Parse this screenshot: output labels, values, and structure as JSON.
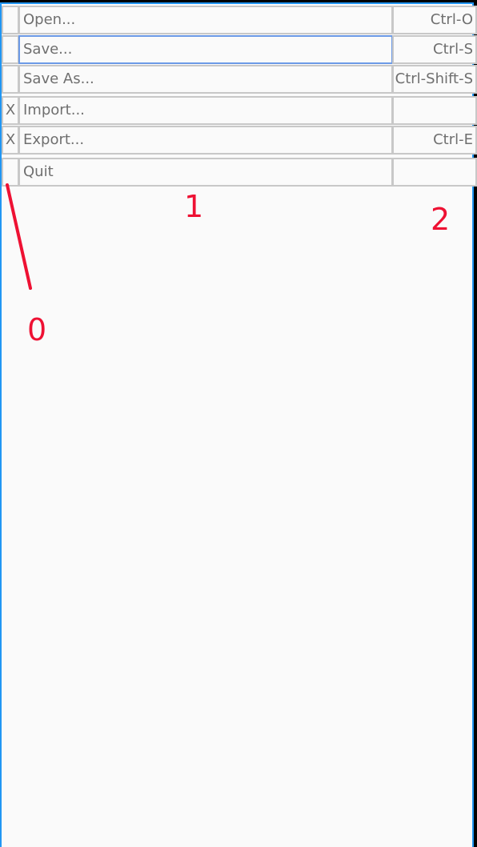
{
  "menu": {
    "items": [
      {
        "check": "",
        "label": "Open...",
        "shortcut": "Ctrl-O"
      },
      {
        "check": "",
        "label": "Save...",
        "shortcut": "Ctrl-S"
      },
      {
        "check": "",
        "label": "Save As...",
        "shortcut": "Ctrl-Shift-S"
      },
      {
        "check": "X",
        "label": "Import...",
        "shortcut": ""
      },
      {
        "check": "X",
        "label": "Export...",
        "shortcut": "Ctrl-E"
      },
      {
        "check": "",
        "label": "Quit",
        "shortcut": ""
      }
    ],
    "focused_item": "Save..."
  },
  "annotations": {
    "column_0": "0",
    "column_1": "1",
    "column_2": "2",
    "color": "#ee1133"
  },
  "colors": {
    "frame_border": "#2196f3",
    "focus_border": "#6c9ae6",
    "cell_border": "#c8c8c8",
    "background": "#fafafa"
  }
}
